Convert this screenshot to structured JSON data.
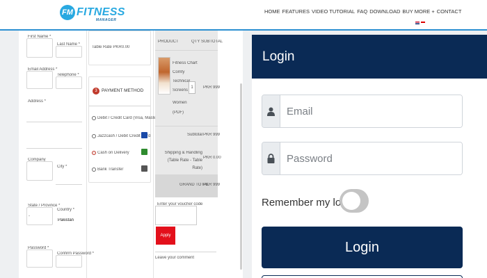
{
  "header": {
    "logo_badge": "FM",
    "logo_text": "FITNESS",
    "logo_sub": "MANAGER",
    "nav": [
      "HOME",
      "FEATURES",
      "VIDEO TUTORIAL",
      "FAQ",
      "DOWNLOAD",
      "BUY MORE +",
      "CONTACT"
    ]
  },
  "order_form": {
    "first_name": "First Name *",
    "last_name": "Last Name *",
    "email_address": "Email Address *",
    "telephone": "Telephone *",
    "address": "Address *",
    "company": "Company",
    "city": "City *",
    "state_province": "State / Province *",
    "state_value": "-",
    "country": "Country *",
    "country_value": "Pakistan",
    "password": "Password *",
    "confirm_password": "Confirm Password *",
    "table_rate": "Table Rate PKR0.00",
    "payment_step": "3",
    "payment_method": "PAYMENT METHOD",
    "payment_options": [
      "Debit / Credit Card (Visa, Master)",
      "Jazzcash / Debit Credit Card",
      "Cash on Delivery",
      "Bank Transfer"
    ],
    "summary_header": [
      "PRODUCT",
      "QTY",
      "SUBTOTAL"
    ],
    "product_lines": [
      "Fitness Chart",
      "Comfy",
      "Technical",
      "Screens For",
      "Women",
      "(PDF)"
    ],
    "product_qty": "1",
    "product_price": "PKR 999",
    "subtotal_label": "Subtotal",
    "subtotal_value": "PKR 999",
    "shipping_label": "Shipping & Handling (Table Rate - Table Rate)",
    "shipping_value": "PKR 0.00",
    "grand_total_label": "GRAND TOTAL",
    "grand_total_value": "PKR 999",
    "voucher_label": "Enter your voucher code",
    "apply_btn": "Apply",
    "comment_label": "Leave your comment"
  },
  "login": {
    "title": "Login",
    "email_placeholder": "Email",
    "password_placeholder": "Password",
    "remember_label": "Remember my login",
    "submit_label": "Login"
  },
  "colors": {
    "brand": "#29a9e1",
    "login_navy": "#0a2a55",
    "apply_red": "#e3101b",
    "header_line": "#2b8fd1"
  },
  "icons": [
    "user-icon",
    "lock-icon",
    "flag-en-icon",
    "flag-id-icon",
    "scroll-bar"
  ]
}
